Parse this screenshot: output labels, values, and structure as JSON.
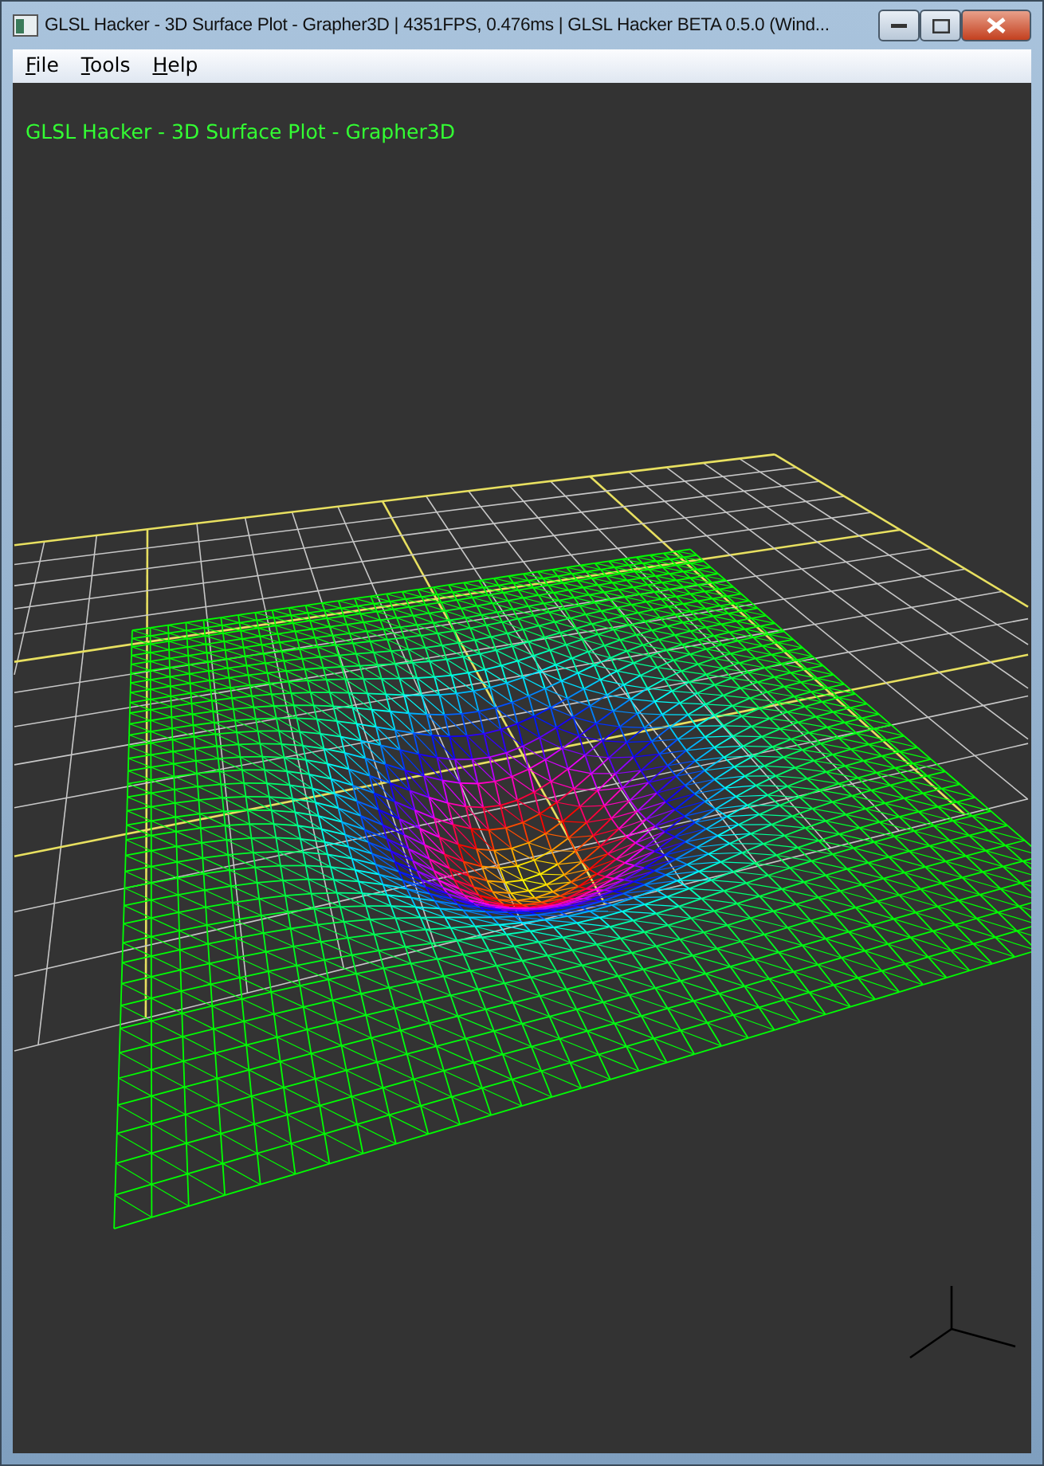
{
  "window": {
    "title": "GLSL Hacker - 3D Surface Plot - Grapher3D | 4351FPS, 0.476ms | GLSL Hacker BETA 0.5.0 (Wind..."
  },
  "menu": [
    {
      "label": "File"
    },
    {
      "label": "Tools"
    },
    {
      "label": "Help"
    }
  ],
  "viewport": {
    "overlay_text": "GLSL Hacker - 3D Surface Plot - Grapher3D"
  }
}
